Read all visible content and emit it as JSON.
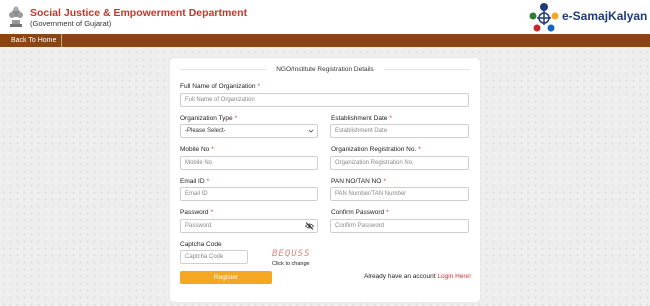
{
  "header": {
    "department": "Social Justice & Empowerment Department",
    "government": "(Government of Gujarat)",
    "brand": "e-SamajKalyan"
  },
  "nav": {
    "back_home": "Back To Home"
  },
  "form": {
    "title": "NGO/Institute Registration Details",
    "org_name": {
      "label": "Full Name of Organization",
      "placeholder": "Full Name of Organization"
    },
    "org_type": {
      "label": "Organization Type",
      "value": "-Please Select-"
    },
    "est_date": {
      "label": "Establishment Date",
      "placeholder": "Establishment Date"
    },
    "mobile": {
      "label": "Mobile No",
      "placeholder": "Mobile No"
    },
    "reg_no": {
      "label": "Organization Registration No.",
      "placeholder": "Organization Registration No."
    },
    "email": {
      "label": "Email ID",
      "placeholder": "Email ID"
    },
    "pan": {
      "label": "PAN NO/TAN NO",
      "placeholder": "PAN Number/TAN Number"
    },
    "password": {
      "label": "Password",
      "placeholder": "Password"
    },
    "confirm_password": {
      "label": "Confirm Password",
      "placeholder": "Confirm Password"
    },
    "captcha": {
      "label": "Captcha Code",
      "placeholder": "Captcha Code",
      "image_text": "BEQUSS",
      "change": "Click to change"
    },
    "register": "Register",
    "login_prompt": "Already have an account",
    "login_link": "Login Here!"
  },
  "colors": {
    "nav": "#8b4513",
    "accent": "#f5a623",
    "required": "#d63030",
    "dept_title": "#c0392b",
    "brand": "#1e3c78"
  }
}
